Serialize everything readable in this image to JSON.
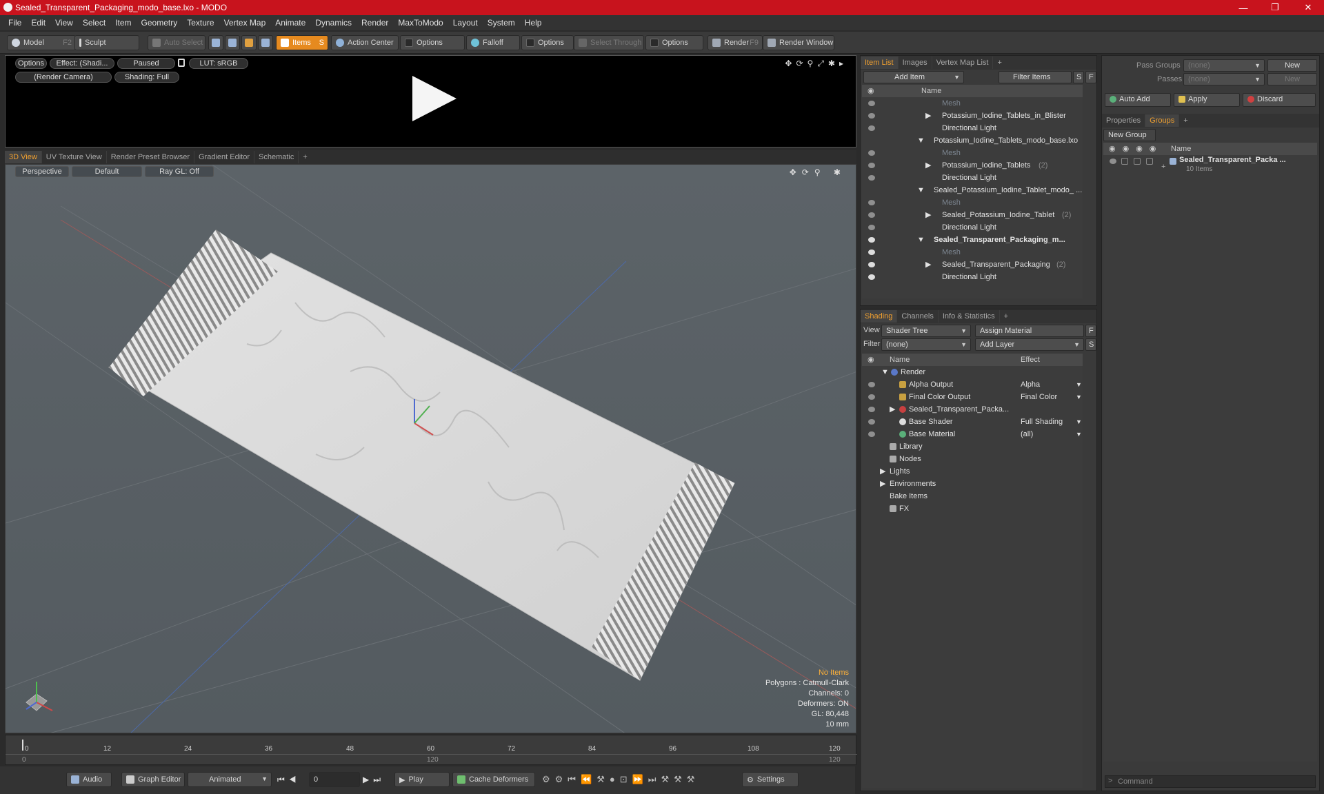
{
  "window": {
    "title": "Sealed_Transparent_Packaging_modo_base.lxo - MODO",
    "min": "—",
    "max": "❐",
    "close": "✕"
  },
  "menu": [
    "File",
    "Edit",
    "View",
    "Select",
    "Item",
    "Geometry",
    "Texture",
    "Vertex Map",
    "Animate",
    "Dynamics",
    "Render",
    "MaxToModo",
    "Layout",
    "System",
    "Help"
  ],
  "toolbar": {
    "model": "Model",
    "model_key": "F2",
    "sculpt": "Sculpt",
    "auto_select": "Auto Select",
    "items": "Items",
    "items_key": "S",
    "action_center": "Action Center",
    "options1": "Options",
    "falloff": "Falloff",
    "options2": "Options",
    "select_through": "Select Through",
    "options3": "Options",
    "render": "Render",
    "render_key": "F9",
    "render_window": "Render Window"
  },
  "preview": {
    "options": "Options",
    "effect": "Effect: (Shadi...",
    "paused": "Paused",
    "lut": "LUT: sRGB",
    "camera": "(Render Camera)",
    "shading": "Shading: Full"
  },
  "viewport_tabs": [
    "3D View",
    "UV Texture View",
    "Render Preset Browser",
    "Gradient Editor",
    "Schematic"
  ],
  "viewport": {
    "perspective": "Perspective",
    "default": "Default",
    "raygl": "Ray GL: Off",
    "hud": {
      "items": "No Items",
      "polygons": "Polygons : Catmull-Clark",
      "channels": "Channels: 0",
      "deformers": "Deformers: ON",
      "gl": "GL: 80,448",
      "scale": "10 mm"
    }
  },
  "timeline": {
    "ticks": [
      "0",
      "12",
      "24",
      "36",
      "48",
      "60",
      "72",
      "84",
      "96",
      "108",
      "120"
    ],
    "sub_left": "0",
    "sub_mid": "120",
    "sub_right": "120"
  },
  "bottombar": {
    "audio": "Audio",
    "graph_editor": "Graph Editor",
    "animated": "Animated",
    "frame": "0",
    "play": "Play",
    "cache": "Cache Deformers",
    "settings": "Settings"
  },
  "itemlist": {
    "tabs": [
      "Item List",
      "Images",
      "Vertex Map List"
    ],
    "add_item": "Add Item",
    "filter": "Filter Items",
    "s": "S",
    "f": "F",
    "col_name": "Name",
    "rows": [
      {
        "label": "Mesh",
        "indent": 2,
        "dim": true
      },
      {
        "label": "Potassium_Iodine_Tablets_in_Blister",
        "indent": 2,
        "dim": false
      },
      {
        "label": "Directional Light",
        "indent": 2,
        "dim": false
      },
      {
        "label": "Potassium_Iodine_Tablets_modo_base.lxo",
        "indent": 1,
        "dim": false
      },
      {
        "label": "Mesh",
        "indent": 2,
        "dim": true
      },
      {
        "label": "Potassium_Iodine_Tablets",
        "count": "(2)",
        "indent": 2,
        "dim": false
      },
      {
        "label": "Directional Light",
        "indent": 2,
        "dim": false
      },
      {
        "label": "Sealed_Potassium_Iodine_Tablet_modo_ ...",
        "indent": 1,
        "dim": false
      },
      {
        "label": "Mesh",
        "indent": 2,
        "dim": true
      },
      {
        "label": "Sealed_Potassium_Iodine_Tablet",
        "count": "(2)",
        "indent": 2,
        "dim": false
      },
      {
        "label": "Directional Light",
        "indent": 2,
        "dim": false
      },
      {
        "label": "Sealed_Transparent_Packaging_m...",
        "indent": 1,
        "dim": false,
        "bold": true
      },
      {
        "label": "Mesh",
        "indent": 2,
        "dim": true
      },
      {
        "label": "Sealed_Transparent_Packaging",
        "count": "(2)",
        "indent": 2,
        "dim": false
      },
      {
        "label": "Directional Light",
        "indent": 2,
        "dim": false
      }
    ]
  },
  "shading": {
    "tabs": [
      "Shading",
      "Channels",
      "Info & Statistics"
    ],
    "view_label": "View",
    "view_value": "Shader Tree",
    "assign": "Assign Material",
    "f": "F",
    "filter_label": "Filter",
    "filter_value": "(none)",
    "add_layer": "Add Layer",
    "s": "S",
    "col_name": "Name",
    "col_effect": "Effect",
    "rows": [
      {
        "label": "Render",
        "effect": "",
        "indent": 0
      },
      {
        "label": "Alpha Output",
        "effect": "Alpha",
        "indent": 1
      },
      {
        "label": "Final Color Output",
        "effect": "Final Color",
        "indent": 1
      },
      {
        "label": "Sealed_Transparent_Packa...",
        "effect": "",
        "indent": 1
      },
      {
        "label": "Base Shader",
        "effect": "Full Shading",
        "indent": 1
      },
      {
        "label": "Base Material",
        "effect": "(all)",
        "indent": 1
      },
      {
        "label": "Library",
        "effect": "",
        "indent": 0
      },
      {
        "label": "Nodes",
        "effect": "",
        "indent": 0
      },
      {
        "label": "Lights",
        "effect": "",
        "indent": 0
      },
      {
        "label": "Environments",
        "effect": "",
        "indent": 0
      },
      {
        "label": "Bake Items",
        "effect": "",
        "indent": 0
      },
      {
        "label": "FX",
        "effect": "",
        "indent": 0
      }
    ]
  },
  "groups": {
    "pass_groups": "Pass Groups",
    "pass_value": "(none)",
    "new": "New",
    "passes": "Passes",
    "passes_value": "(none)",
    "new2": "New",
    "auto_add": "Auto Add",
    "apply": "Apply",
    "discard": "Discard",
    "tabs": [
      "Properties",
      "Groups"
    ],
    "new_group": "New Group",
    "col_name": "Name",
    "group_name": "Sealed_Transparent_Packa ...",
    "group_count": "10 Items"
  },
  "command": {
    "placeholder": "Command"
  },
  "colors": {
    "accent": "#f0a030",
    "title": "#c8131d"
  }
}
